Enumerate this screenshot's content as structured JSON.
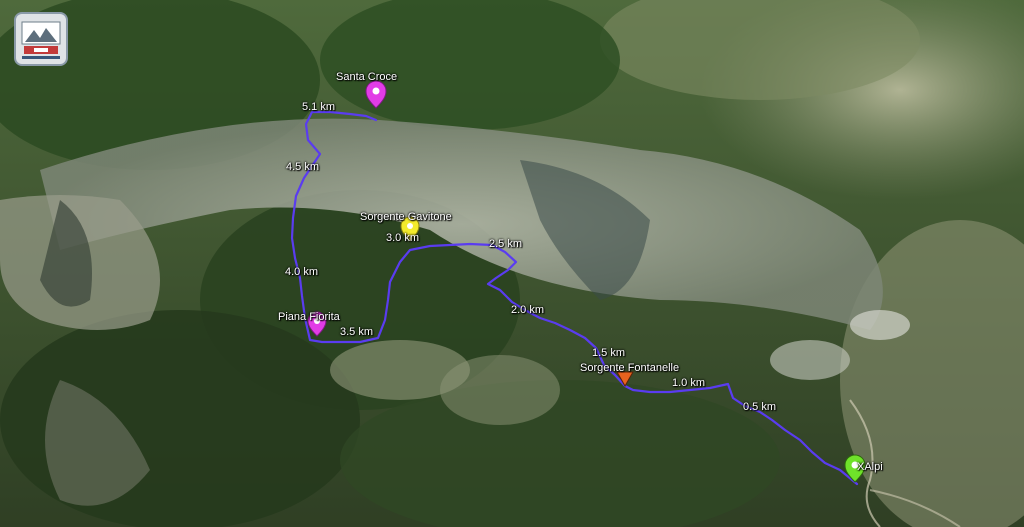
{
  "route_color": "#5a3cf0",
  "colors": {
    "pin_magenta": "#e23ce6",
    "pin_yellow": "#f2ea2c",
    "pin_orange": "#e8621e",
    "pin_green": "#6fe22a"
  },
  "pins": [
    {
      "name": "santa-croce",
      "label": "Santa Croce",
      "color": "pin_magenta",
      "shape": "balloon"
    },
    {
      "name": "sorgente-gavitone",
      "label": "Sorgente Gavitone",
      "color": "pin_yellow",
      "shape": "balloon"
    },
    {
      "name": "piana-fiorita",
      "label": "Piana Fiorita",
      "color": "pin_magenta",
      "shape": "balloon"
    },
    {
      "name": "sorgente-fontanelle",
      "label": "Sorgente Fontanelle",
      "color": "pin_orange",
      "shape": "triangle"
    },
    {
      "name": "xalpi",
      "label": "XAlpi",
      "color": "pin_green",
      "shape": "balloon"
    }
  ],
  "distance_markers": [
    "0.5 km",
    "1.0 km",
    "1.5 km",
    "2.0 km",
    "2.5 km",
    "3.0 km",
    "3.5 km",
    "4.0 km",
    "4.5 km",
    "5.1 km"
  ],
  "logo": {
    "icon": "club-logo-icon"
  }
}
